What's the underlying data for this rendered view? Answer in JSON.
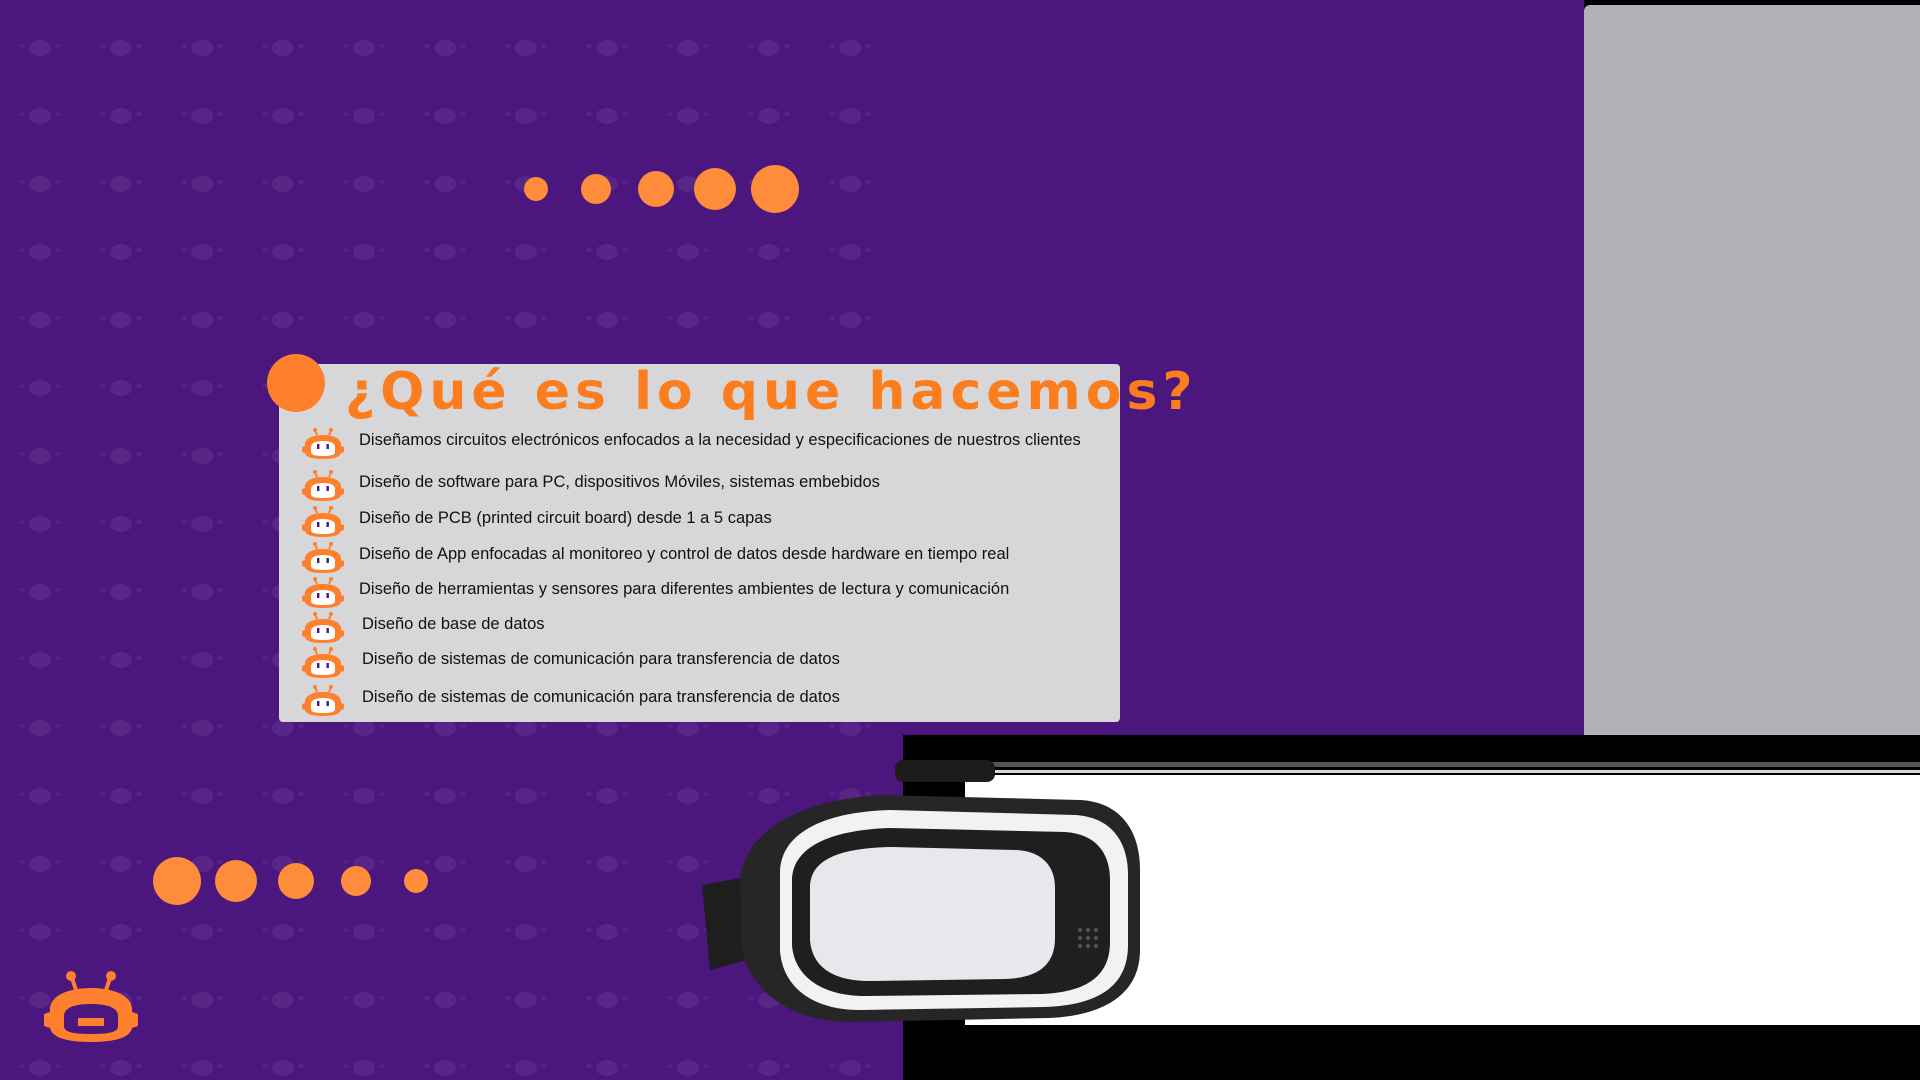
{
  "colors": {
    "purple": "#4b167e",
    "orange": "#fe8c3a",
    "title_orange": "#fb7d1e",
    "card_gray": "#d7d7d9",
    "panel_gray": "#b3b1b6"
  },
  "section": {
    "title": "¿Qué es lo que hacemos?",
    "items": [
      {
        "label": "Diseñamos circuitos electrónicos enfocados a la necesidad y especificaciones de nuestros clientes",
        "icon": "robot-head-icon"
      },
      {
        "label": "Diseño de software para PC, dispositivos Móviles, sistemas embebidos",
        "icon": "robot-head-icon"
      },
      {
        "label": "Diseño de PCB (printed circuit board) desde 1 a 5 capas",
        "icon": "robot-head-icon"
      },
      {
        "label": "Diseño de App enfocadas al monitoreo y control de datos desde hardware en tiempo real",
        "icon": "robot-head-icon"
      },
      {
        "label": "Diseño de herramientas y sensores para diferentes ambientes de lectura y comunicación",
        "icon": "robot-head-icon"
      },
      {
        "label": "Diseño de base de datos",
        "icon": "robot-head-icon"
      },
      {
        "label": "Diseño de sistemas de comunicación para transferencia de datos",
        "icon": "robot-head-icon"
      },
      {
        "label": "Diseño de sistemas de comunicación para transferencia de datos",
        "icon": "robot-head-icon"
      }
    ]
  },
  "decor": {
    "vr_image": "vr-headset-image",
    "logo": "robot-logo-icon"
  }
}
